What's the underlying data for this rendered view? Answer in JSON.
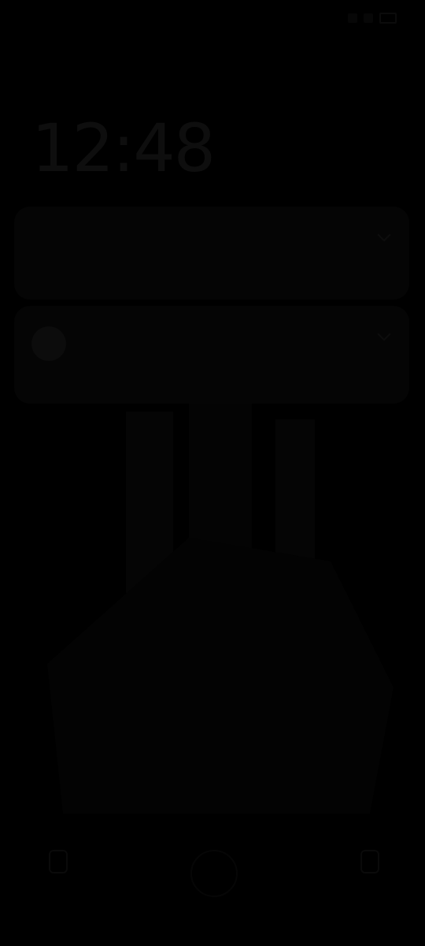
{
  "screen": {
    "background": "#000000",
    "state": "display off / always-on dimmed lock screen"
  },
  "status_bar": {
    "icons": [
      "signal-icon",
      "wifi-icon",
      "battery-icon"
    ]
  },
  "lock_screen": {
    "date": "",
    "clock": "12:48"
  },
  "notifications": [
    {
      "title": "",
      "text": ""
    },
    {
      "title": "",
      "text": ""
    }
  ],
  "bottom": {
    "unlock_hint": ""
  },
  "colors": {
    "background": "#000000"
  }
}
